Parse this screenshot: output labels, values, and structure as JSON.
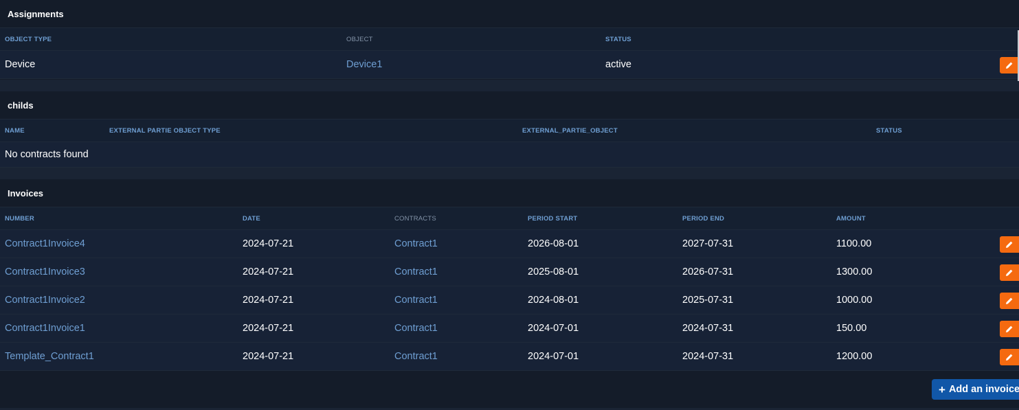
{
  "assignments": {
    "title": "Assignments",
    "columns": [
      "OBJECT TYPE",
      "OBJECT",
      "STATUS"
    ],
    "rows": [
      {
        "object_type": "Device",
        "object": "Device1",
        "status": "active"
      }
    ]
  },
  "childs": {
    "title": "childs",
    "columns": [
      "NAME",
      "EXTERNAL PARTIE OBJECT TYPE",
      "EXTERNAL_PARTIE_OBJECT",
      "STATUS"
    ],
    "empty_text": "No contracts found"
  },
  "invoices": {
    "title": "Invoices",
    "columns": [
      "NUMBER",
      "DATE",
      "CONTRACTS",
      "PERIOD START",
      "PERIOD END",
      "AMOUNT"
    ],
    "rows": [
      {
        "number": "Contract1Invoice4",
        "date": "2024-07-21",
        "contract": "Contract1",
        "period_start": "2026-08-01",
        "period_end": "2027-07-31",
        "amount": "1100.00"
      },
      {
        "number": "Contract1Invoice3",
        "date": "2024-07-21",
        "contract": "Contract1",
        "period_start": "2025-08-01",
        "period_end": "2026-07-31",
        "amount": "1300.00"
      },
      {
        "number": "Contract1Invoice2",
        "date": "2024-07-21",
        "contract": "Contract1",
        "period_start": "2024-08-01",
        "period_end": "2025-07-31",
        "amount": "1000.00"
      },
      {
        "number": "Contract1Invoice1",
        "date": "2024-07-21",
        "contract": "Contract1",
        "period_start": "2024-07-01",
        "period_end": "2024-07-31",
        "amount": "150.00"
      },
      {
        "number": "Template_Contract1",
        "date": "2024-07-21",
        "contract": "Contract1",
        "period_start": "2024-07-01",
        "period_end": "2024-07-31",
        "amount": "1200.00"
      }
    ],
    "add_button_label": "Add an invoice",
    "edit_icon": "pencil-icon",
    "add_icon": "plus-icon"
  },
  "colors": {
    "background": "#141c29",
    "link": "#6f9fd3",
    "edit_button": "#f56a10",
    "add_button": "#1157a8"
  }
}
